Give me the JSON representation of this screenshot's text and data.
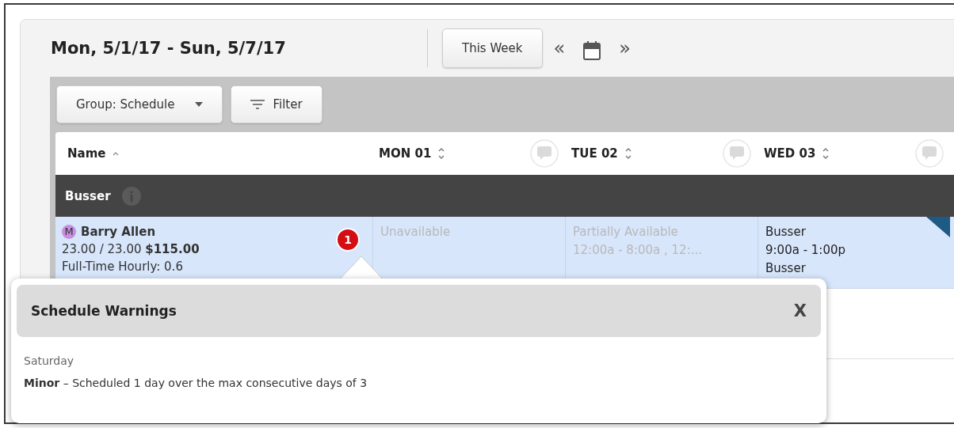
{
  "header": {
    "date_range": "Mon, 5/1/17 - Sun, 5/7/17",
    "this_week_button": "This Week",
    "prev_label": "«",
    "next_label": "»"
  },
  "toolbar": {
    "group_button": "Group: Schedule",
    "filter_button": "Filter"
  },
  "table": {
    "columns": [
      {
        "label": "Name",
        "kind": "name"
      },
      {
        "label": "MON 01",
        "kind": "day"
      },
      {
        "label": "TUE 02",
        "kind": "day"
      },
      {
        "label": "WED 03",
        "kind": "day"
      }
    ],
    "groups": [
      {
        "title": "Busser",
        "rows": [
          {
            "role_badge": "M",
            "color": "#c88ee0",
            "name": "Barry Allen",
            "hours": "23.00 / 23.00 **$115.00**",
            "type": "Full-Time Hourly: 0.6",
            "warnings": "1",
            "selected": true,
            "cells": [
              {
                "kind": "unavailable",
                "flagged": false,
                "lines": [
                  "Unavailable"
                ]
              },
              {
                "kind": "unavailable",
                "flagged": false,
                "lines": [
                  "Partially Available",
                  "12:00a - 8:00a , 12:..."
                ]
              },
              {
                "kind": "shift",
                "flagged": true,
                "lines": [
                  "Busser",
                  "9:00a - 1:00p",
                  "Busser"
                ]
              }
            ]
          }
        ]
      }
    ]
  },
  "popover": {
    "title": "Schedule Warnings",
    "close_label": "X",
    "warnings": [
      {
        "day": "Saturday",
        "message": "**Minor** – Scheduled 1 day over the max consecutive days of 3"
      }
    ]
  }
}
